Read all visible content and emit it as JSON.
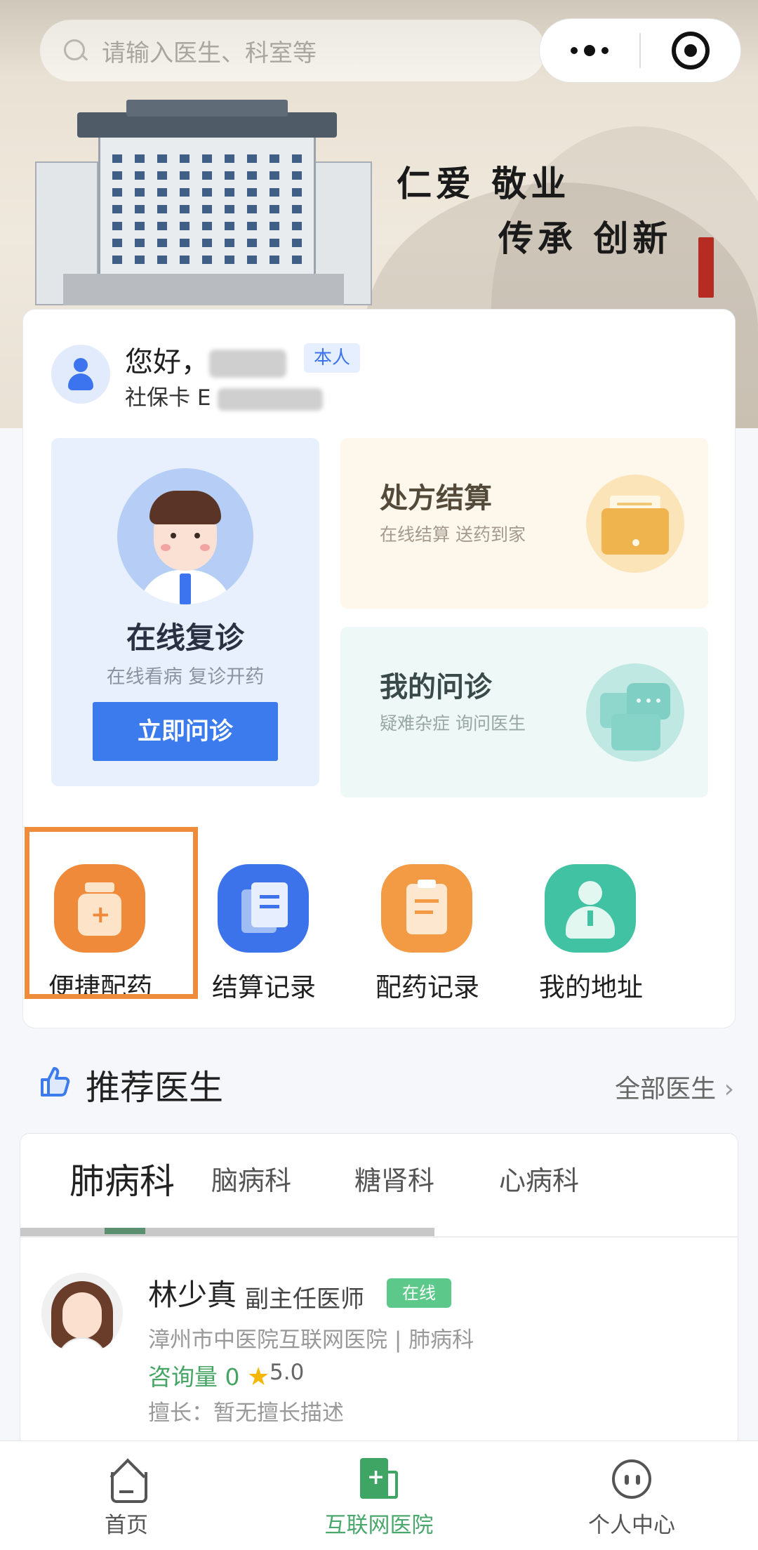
{
  "search": {
    "placeholder": "请输入医生、科室等"
  },
  "banner": {
    "slogan_line1": "仁爱  敬业",
    "slogan_line2": "传承  创新"
  },
  "user": {
    "greeting": "您好，",
    "badge": "本人",
    "card_label": "社保卡 E"
  },
  "main_tile": {
    "title": "在线复诊",
    "subtitle": "在线看病 复诊开药",
    "button": "立即问诊"
  },
  "side_tiles": [
    {
      "title": "处方结算",
      "subtitle": "在线结算 送药到家"
    },
    {
      "title": "我的问诊",
      "subtitle": "疑难杂症 询问医生"
    }
  ],
  "shortcuts": [
    {
      "label": "便捷配药",
      "icon": "medicine-bottle-icon",
      "color": "#ef8a3a"
    },
    {
      "label": "结算记录",
      "icon": "document-icon",
      "color": "#3d73ea"
    },
    {
      "label": "配药记录",
      "icon": "clipboard-icon",
      "color": "#f29a44"
    },
    {
      "label": "我的地址",
      "icon": "person-pin-icon",
      "color": "#41c2a3"
    }
  ],
  "recommend": {
    "title": "推荐医生",
    "more": "全部医生"
  },
  "dept_tabs": [
    "肺病科",
    "脑病科",
    "糖肾科",
    "心病科"
  ],
  "doctor": {
    "name": "林少真",
    "title": "副主任医师",
    "status": "在线",
    "hospital": "漳州市中医院互联网医院 | 肺病科",
    "consult": "咨询量 0",
    "rating": "5.0",
    "specialty": "擅长：暂无擅长描述"
  },
  "tabbar": [
    {
      "label": "首页",
      "icon": "home-icon"
    },
    {
      "label": "互联网医院",
      "icon": "hospital-icon"
    },
    {
      "label": "个人中心",
      "icon": "profile-face-icon"
    }
  ],
  "colors": {
    "primary": "#3c7bee",
    "active_green": "#4aa86c",
    "highlight": "#ef8c3c"
  }
}
